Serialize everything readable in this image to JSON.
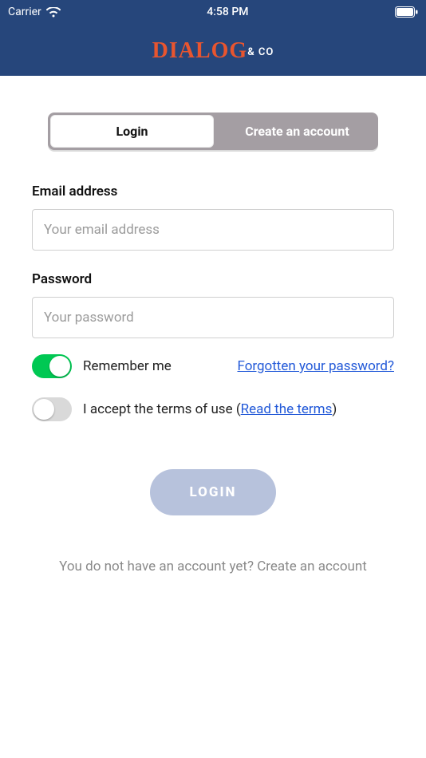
{
  "status_bar": {
    "carrier": "Carrier",
    "time": "4:58 PM"
  },
  "brand": {
    "main": "DIALOG",
    "sub": "& CO"
  },
  "tabs": {
    "login": "Login",
    "create": "Create an account"
  },
  "form": {
    "email_label": "Email address",
    "email_placeholder": "Your email address",
    "password_label": "Password",
    "password_placeholder": "Your password",
    "remember_label": "Remember me",
    "forgot_label": "Forgotten your password?",
    "terms_prefix": "I accept the terms of use (",
    "terms_link": "Read the terms",
    "terms_suffix": ")",
    "submit_label": "LOGIN"
  },
  "footer": {
    "text": "You do not have an account yet? Create an account"
  }
}
